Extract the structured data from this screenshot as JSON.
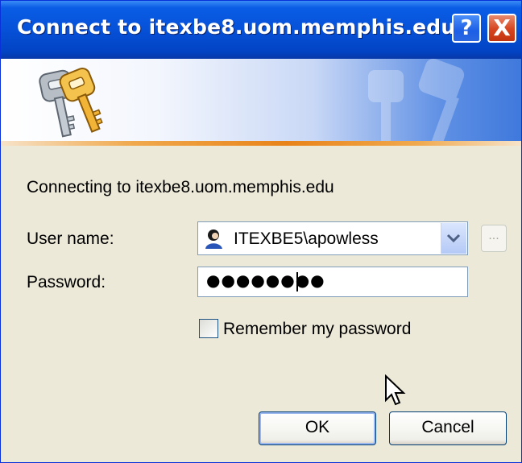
{
  "window": {
    "title": "Connect to itexbe8.uom.memphis.edu",
    "help_glyph": "?",
    "close_glyph": "X"
  },
  "banner": {
    "icon": "keys-icon"
  },
  "dialog": {
    "connecting_text": "Connecting to itexbe8.uom.memphis.edu",
    "username_label": "User name:",
    "username_value": "ITEXBE5\\apowless",
    "username_icon": "user-icon",
    "browse_label": "...",
    "password_label": "Password:",
    "password_value": "●●●●●●●●",
    "remember_label": "Remember my password",
    "remember_checked": false,
    "ok_label": "OK",
    "cancel_label": "Cancel"
  },
  "colors": {
    "titlebar": "#0651d8",
    "dialog_bg": "#ece9d8",
    "accent_line": "#e8831a",
    "close_button": "#d6451f"
  }
}
